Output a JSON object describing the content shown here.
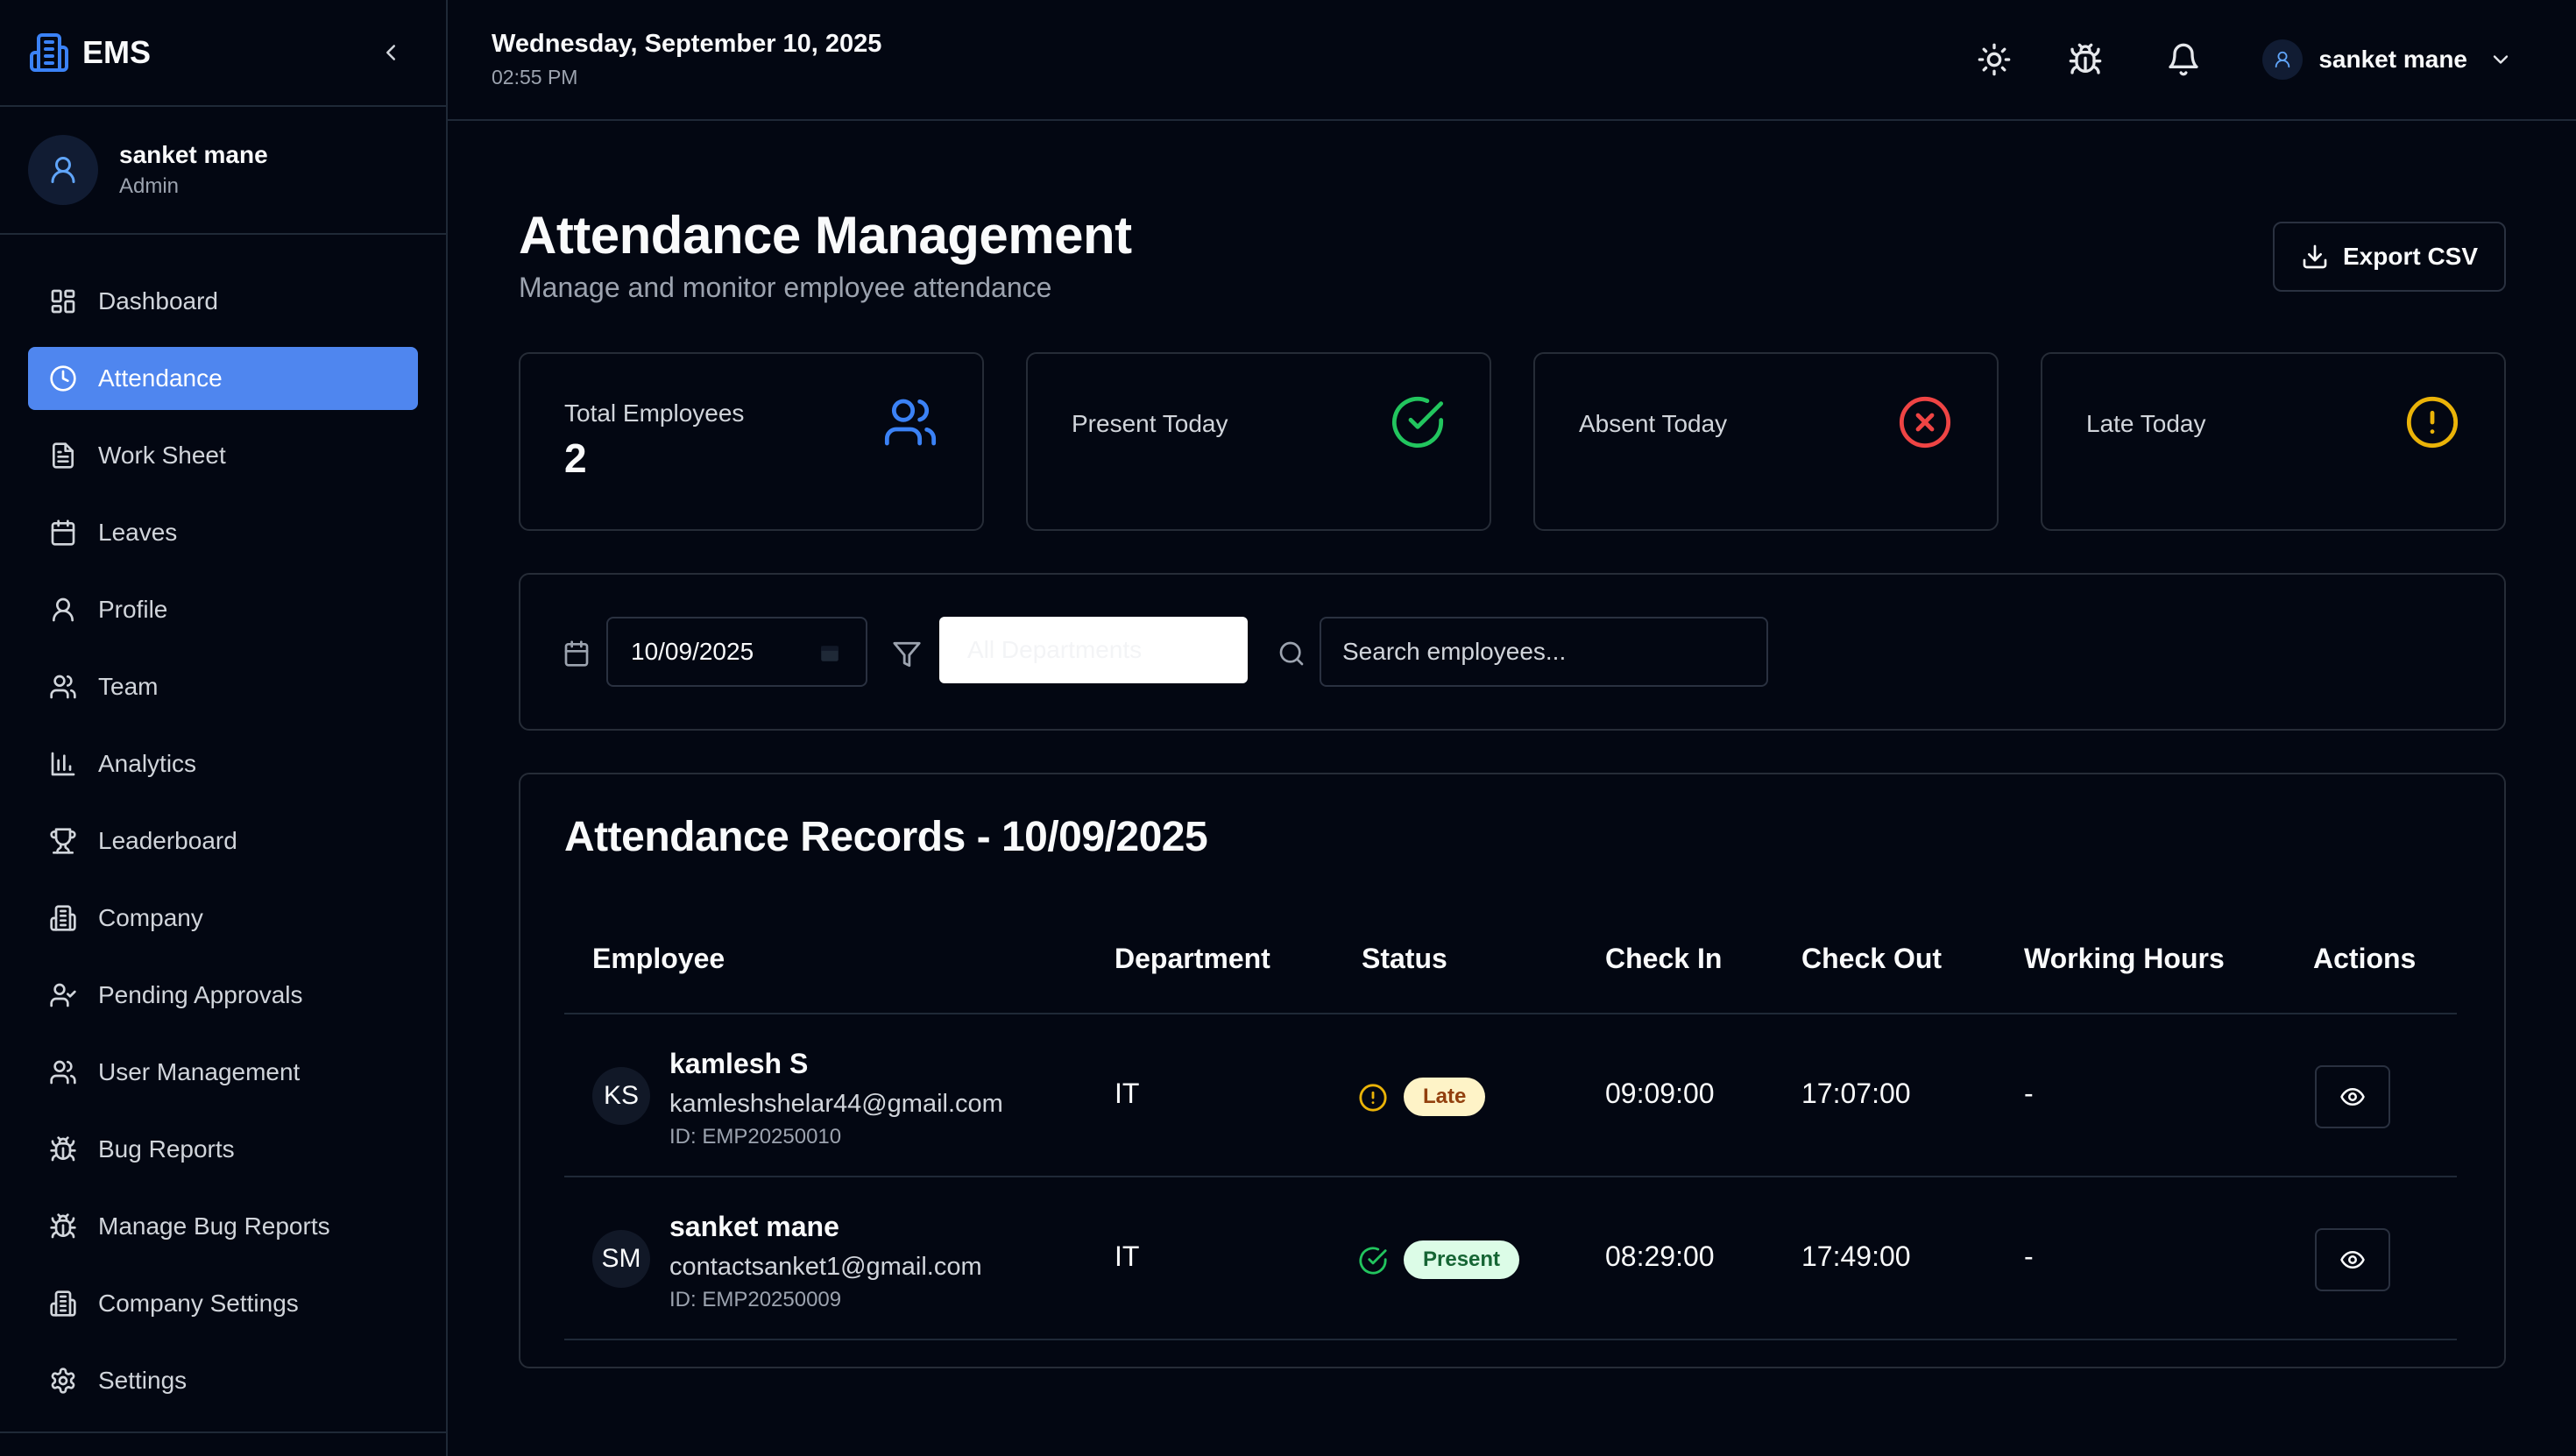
{
  "app": {
    "name": "EMS"
  },
  "sidebar": {
    "user": {
      "name": "sanket mane",
      "role": "Admin"
    },
    "items": [
      {
        "label": "Dashboard",
        "icon": "dashboard-icon",
        "active": false
      },
      {
        "label": "Attendance",
        "icon": "clock-icon",
        "active": true
      },
      {
        "label": "Work Sheet",
        "icon": "document-icon",
        "active": false
      },
      {
        "label": "Leaves",
        "icon": "calendar-icon",
        "active": false
      },
      {
        "label": "Profile",
        "icon": "user-icon",
        "active": false
      },
      {
        "label": "Team",
        "icon": "users-icon",
        "active": false
      },
      {
        "label": "Analytics",
        "icon": "bar-chart-icon",
        "active": false
      },
      {
        "label": "Leaderboard",
        "icon": "trophy-icon",
        "active": false
      },
      {
        "label": "Company",
        "icon": "building-icon",
        "active": false
      },
      {
        "label": "Pending Approvals",
        "icon": "user-check-icon",
        "active": false
      },
      {
        "label": "User Management",
        "icon": "users-icon",
        "active": false
      },
      {
        "label": "Bug Reports",
        "icon": "bug-icon",
        "active": false
      },
      {
        "label": "Manage Bug Reports",
        "icon": "bug-icon",
        "active": false
      },
      {
        "label": "Company Settings",
        "icon": "building-icon",
        "active": false
      },
      {
        "label": "Settings",
        "icon": "gear-icon",
        "active": false
      }
    ]
  },
  "header": {
    "date": "Wednesday, September 10, 2025",
    "time": "02:55 PM",
    "user_name": "sanket mane"
  },
  "page": {
    "title": "Attendance Management",
    "subtitle": "Manage and monitor employee attendance",
    "export_label": "Export CSV"
  },
  "stats": [
    {
      "label": "Total Employees",
      "value": "2",
      "icon": "users-icon",
      "color": "#3b82f6"
    },
    {
      "label": "Present Today",
      "value": "",
      "icon": "check-circle-icon",
      "color": "#22c55e"
    },
    {
      "label": "Absent Today",
      "value": "",
      "icon": "x-circle-icon",
      "color": "#ef4444"
    },
    {
      "label": "Late Today",
      "value": "",
      "icon": "alert-circle-icon",
      "color": "#eab308"
    }
  ],
  "filters": {
    "date_value": "10/09/2025",
    "department_value": "All Departments",
    "search_placeholder": "Search employees..."
  },
  "records": {
    "title": "Attendance Records - 10/09/2025",
    "columns": [
      "Employee",
      "Department",
      "Status",
      "Check In",
      "Check Out",
      "Working Hours",
      "Actions"
    ],
    "rows": [
      {
        "initials": "KS",
        "name": "kamlesh S",
        "email": "kamleshshelar44@gmail.com",
        "id": "ID: EMP20250010",
        "department": "IT",
        "status": "Late",
        "status_color": "#eab308",
        "badge_bg": "#fef3c7",
        "badge_fg": "#92400e",
        "check_in": "09:09:00",
        "check_out": "17:07:00",
        "working_hours": "-"
      },
      {
        "initials": "SM",
        "name": "sanket mane",
        "email": "contactsanket1@gmail.com",
        "id": "ID: EMP20250009",
        "department": "IT",
        "status": "Present",
        "status_color": "#22c55e",
        "badge_bg": "#dcfce7",
        "badge_fg": "#166534",
        "check_in": "08:29:00",
        "check_out": "17:49:00",
        "working_hours": "-"
      }
    ]
  },
  "colors": {
    "accent": "#4f86ef",
    "background": "#030712",
    "border": "#262c37"
  }
}
